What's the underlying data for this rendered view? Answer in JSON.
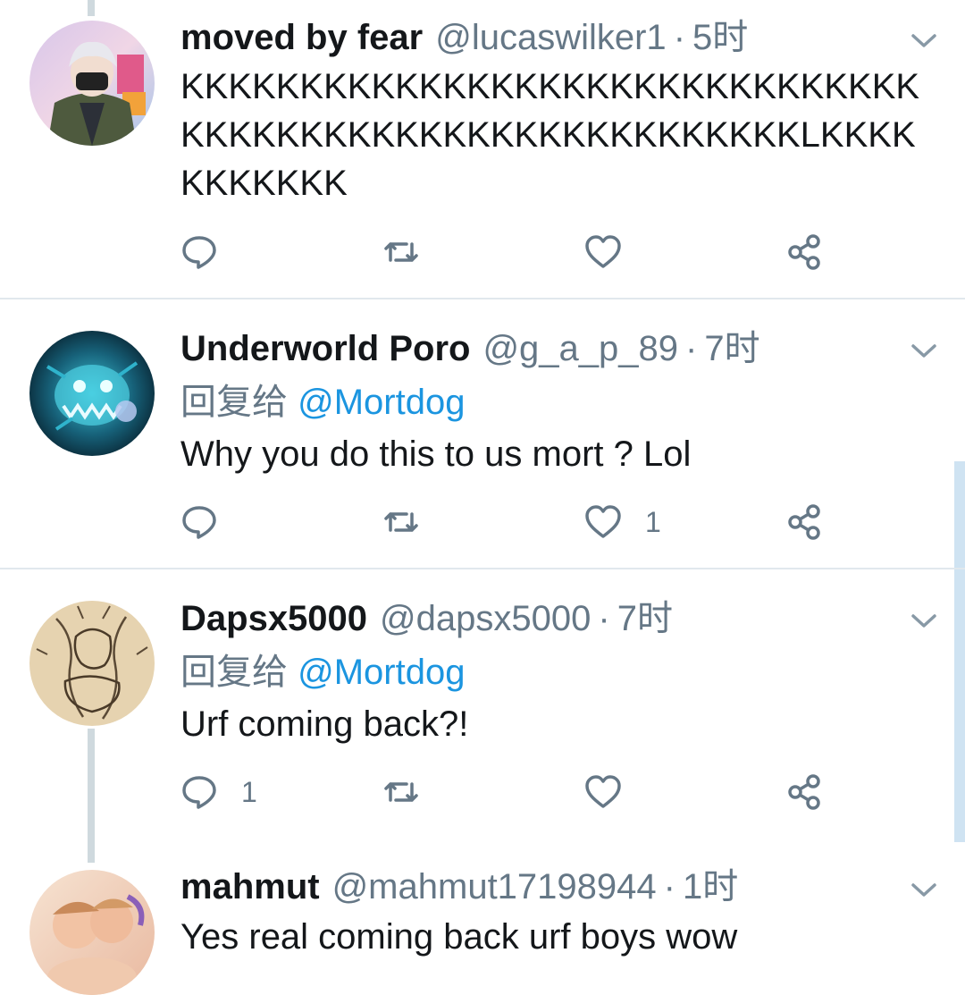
{
  "tweets": [
    {
      "name": "moved by fear",
      "handle": "@lucaswilker1",
      "time": "5时",
      "reply_prefix": "",
      "reply_mention": "",
      "text": "KKKKKKKKKKKKKKKKKKKKKKKKKKKKKKKKKKKKKKKKKKKKKKKKKKKKKKKKKLKKKKKKKKKKK",
      "reply_count": "",
      "like_count": ""
    },
    {
      "name": "Underworld Poro",
      "handle": "@g_a_p_89",
      "time": "7时",
      "reply_prefix": "回复给",
      "reply_mention": "@Mortdog",
      "text": "Why you do this to us mort ? Lol",
      "reply_count": "",
      "like_count": "1"
    },
    {
      "name": "Dapsx5000",
      "handle": "@dapsx5000",
      "time": "7时",
      "reply_prefix": "回复给",
      "reply_mention": "@Mortdog",
      "text": "Urf coming back?!",
      "reply_count": "1",
      "like_count": ""
    },
    {
      "name": "mahmut",
      "handle": "@mahmut17198944",
      "time": "1时",
      "reply_prefix": "",
      "reply_mention": "",
      "text": "Yes real coming back urf boys wow",
      "reply_count": "",
      "like_count": ""
    }
  ],
  "separator": "·",
  "colors": {
    "link": "#1b95e0",
    "muted": "#657786",
    "divider": "#e1e8ed",
    "thread_line": "#cfd9de"
  },
  "icons": [
    "reply-icon",
    "retweet-icon",
    "like-icon",
    "share-icon",
    "chevron-down-icon"
  ]
}
